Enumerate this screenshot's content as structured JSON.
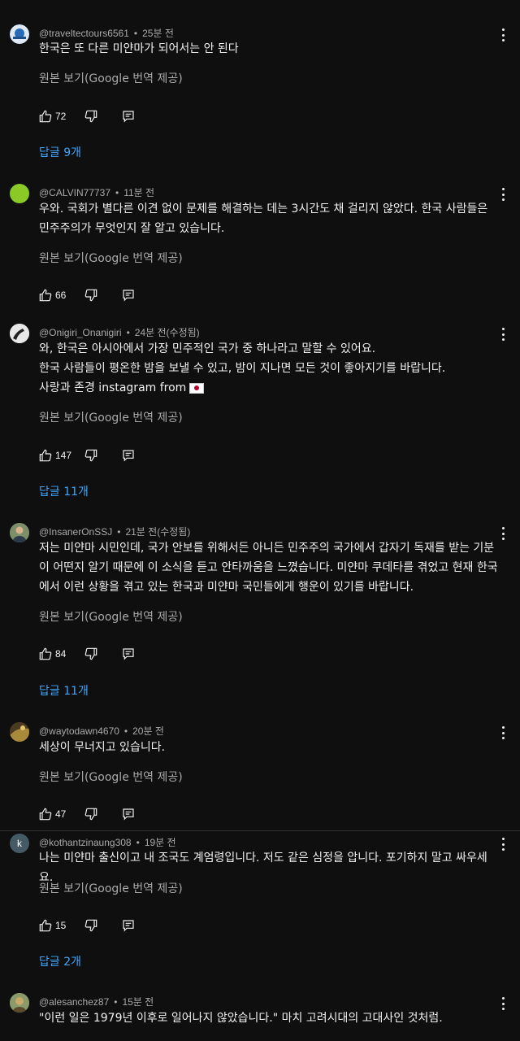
{
  "translate_label": "원본 보기(Google 번역 제공)",
  "comments": [
    {
      "handle": "@traveltectours6561",
      "time": "25분 전",
      "text": [
        "한국은 또 다른 미얀마가 되어서는 안 된다"
      ],
      "likes": "72",
      "replies": "답글 9개",
      "avatar_bg": "#1b4f8a"
    },
    {
      "handle": "@CALVIN77737",
      "time": "11분 전",
      "text": [
        "우와. 국회가 별다른 이견 없이 문제를 해결하는 데는 3시간도 채 걸리지 않았다. 한국 사람들은",
        "민주주의가 무엇인지 잘 알고 있습니다."
      ],
      "likes": "66",
      "replies": "",
      "avatar_bg": "#8ac926"
    },
    {
      "handle": "@Onigiri_Onanigiri",
      "time": "24분 전(수정됨)",
      "text": [
        "와, 한국은 아시아에서 가장 민주적인 국가 중 하나라고 말할 수 있어요.",
        "한국 사람들이 평온한 밤을 보낼 수 있고, 밤이 지나면 모든 것이 좋아지기를 바랍니다.",
        "사랑과 존경 instagram from"
      ],
      "likes": "147",
      "replies": "답글 11개",
      "avatar_bg": "#e8e8e8"
    },
    {
      "handle": "@InsanerOnSSJ",
      "time": "21분 전(수정됨)",
      "text": [
        "저는 미얀마 시민인데, 국가 안보를 위해서든 아니든 민주주의 국가에서 갑자기 독재를 받는 기분",
        "이 어떤지 알기 때문에 이 소식을 듣고 안타까움을 느꼈습니다. 미얀마 쿠데타를 겪었고 현재 한국",
        "에서 이런 상황을 겪고 있는 한국과 미얀마 국민들에게 행운이 있기를 바랍니다."
      ],
      "likes": "84",
      "replies": "답글 11개",
      "avatar_bg": "#5a6b7a"
    },
    {
      "handle": "@waytodawn4670",
      "time": "20분 전",
      "text": [
        "세상이 무너지고 있습니다."
      ],
      "likes": "47",
      "replies": "",
      "avatar_bg": "#6b4a2a"
    },
    {
      "handle": "@kothantzinaung308",
      "time": "19분 전",
      "avatar_letter": "k",
      "text": [
        "나는 미얀마 출신이고 내 조국도 계엄령입니다. 저도 같은 심정을 압니다. 포기하지 말고 싸우세요."
      ],
      "likes": "15",
      "replies": "답글 2개",
      "avatar_bg": "#455a64"
    },
    {
      "handle": "@alesanchez87",
      "time": "15분 전",
      "text": [
        "\"이런 일은 1979년 이후로 일어나지 않았습니다.\" 마치 고려시대의 고대사인 것처럼."
      ],
      "likes": "",
      "replies": "",
      "avatar_bg": "#9c8a5a"
    }
  ]
}
